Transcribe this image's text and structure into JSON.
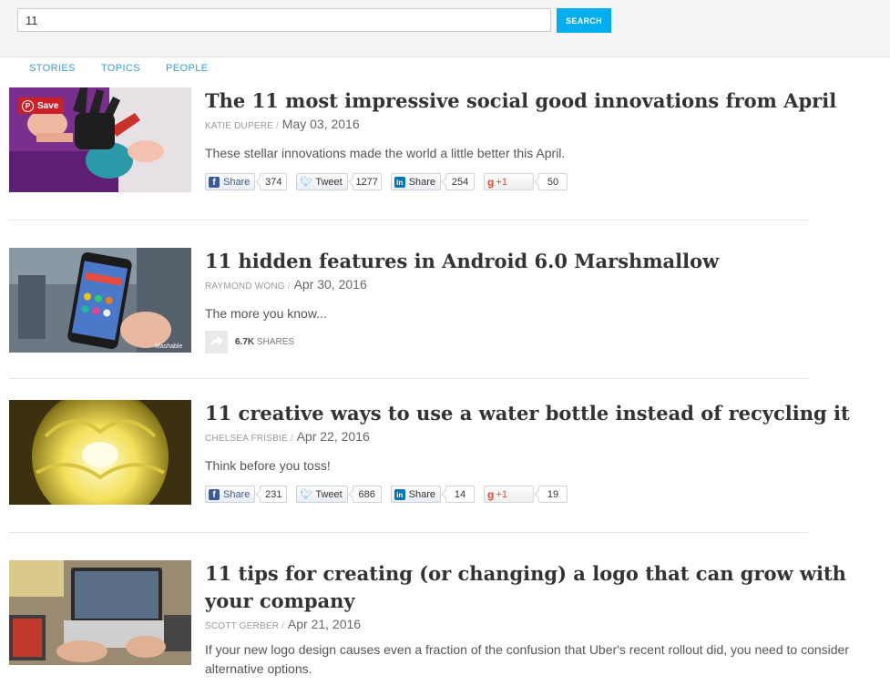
{
  "search": {
    "value": "11",
    "button_label": "SEARCH"
  },
  "tabs": [
    "STORIES",
    "TOPICS",
    "PEOPLE"
  ],
  "pin_save_label": "Save",
  "watermark": "Mashable",
  "stories": [
    {
      "title": "The 11 most impressive social good innovations from April",
      "author": "KATIE DUPERE",
      "sep": "/",
      "date": "May 03, 2016",
      "description": "These stellar innovations made the world a little better this April.",
      "social": {
        "fb_label": "Share",
        "fb_count": "374",
        "tw_label": "Tweet",
        "tw_count": "1277",
        "li_label": "Share",
        "li_count": "254",
        "gp_label": "+1",
        "gp_count": "50"
      }
    },
    {
      "title": "11 hidden features in Android 6.0 Marshmallow",
      "author": "RAYMOND WONG",
      "sep": "/",
      "date": "Apr 30, 2016",
      "description": "The more you know...",
      "shares_count": "6.7K",
      "shares_label": "SHARES"
    },
    {
      "title": "11 creative ways to use a water bottle instead of recycling it",
      "author": "CHELSEA FRISBIE",
      "sep": "/",
      "date": "Apr 22, 2016",
      "description": "Think before you toss!",
      "social": {
        "fb_label": "Share",
        "fb_count": "231",
        "tw_label": "Tweet",
        "tw_count": "686",
        "li_label": "Share",
        "li_count": "14",
        "gp_label": "+1",
        "gp_count": "19"
      }
    },
    {
      "title": "11 tips for creating (or changing) a logo that can grow with your company",
      "author": "SCOTT GERBER",
      "sep": "/",
      "date": "Apr 21, 2016",
      "description": "If your new logo design causes even a fraction of the confusion that Uber's recent rollout did, you need to consider alternative options."
    }
  ],
  "colors": {
    "accent": "#00aeef",
    "tab_link": "#3a9fcf",
    "facebook": "#3b5998",
    "linkedin": "#0077b5",
    "twitter": "#55acee",
    "gplus": "#dd4b39",
    "pinterest": "#cb2027"
  }
}
